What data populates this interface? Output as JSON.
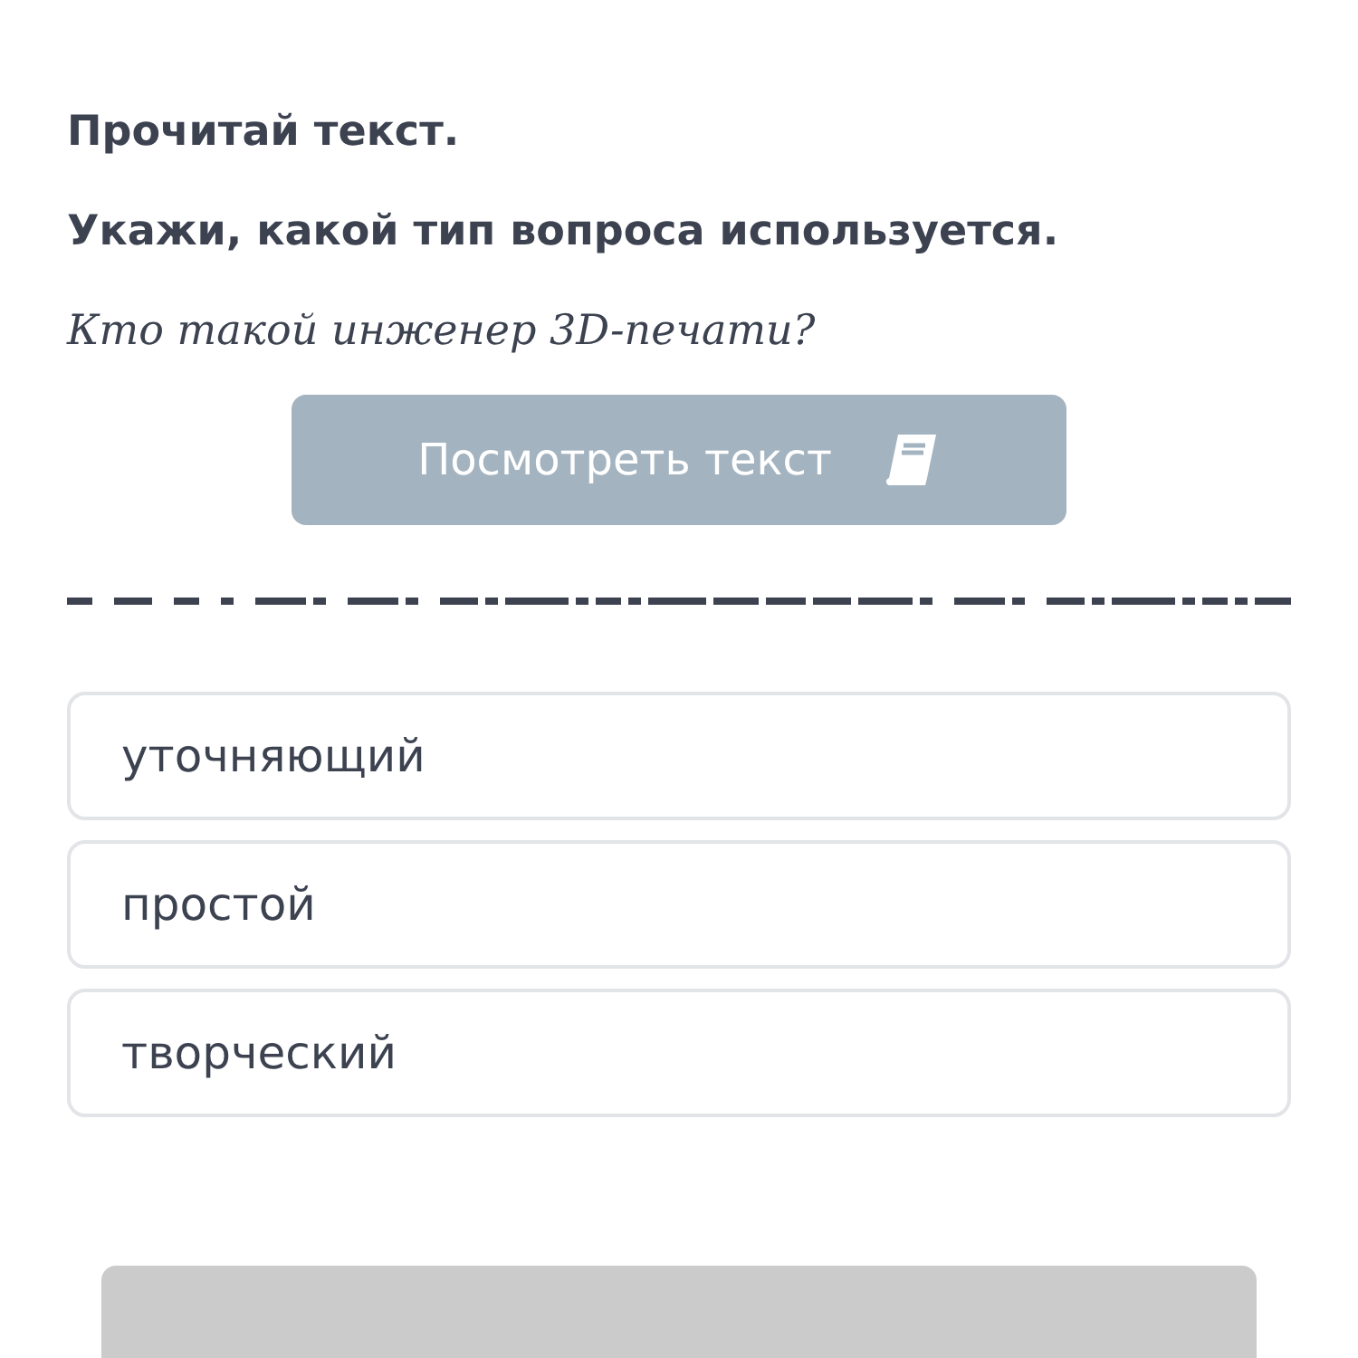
{
  "instructions": [
    "Прочитай текст.",
    "Укажи, какой тип вопроса используется."
  ],
  "question": "Кто такой инженер 3D-печати?",
  "view_text_button": {
    "label": "Посмотреть текст"
  },
  "options": [
    {
      "label": "уточняющий",
      "selected": false
    },
    {
      "label": "простой",
      "selected": false
    },
    {
      "label": "творческий",
      "selected": false
    }
  ],
  "submit_button": {
    "disabled": true
  }
}
